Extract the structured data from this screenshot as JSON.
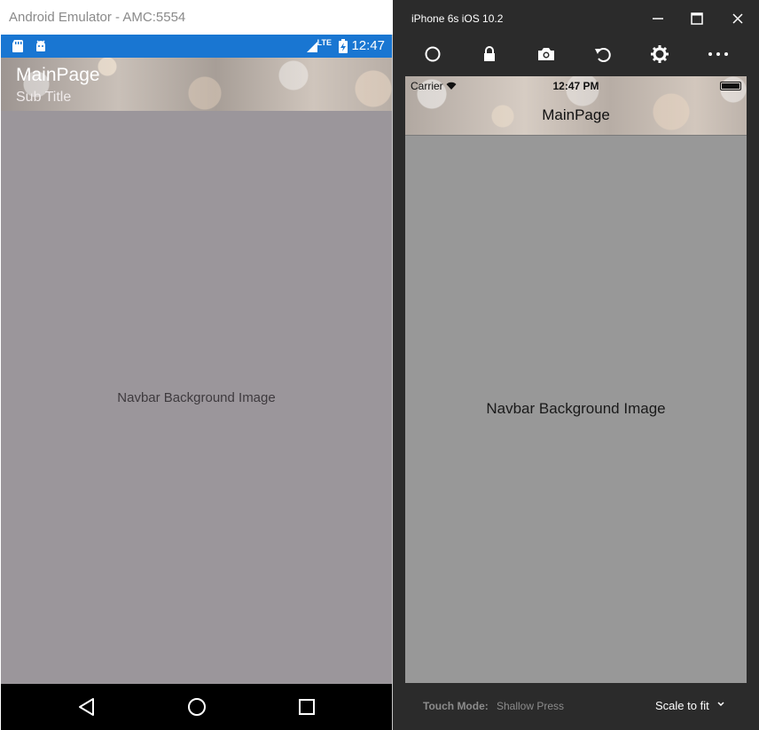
{
  "android": {
    "window_title": "Android Emulator - AMC:5554",
    "status_time": "12:47",
    "status_network": "LTE",
    "toolbar": {
      "title": "MainPage",
      "subtitle": "Sub Title"
    },
    "content_label": "Navbar Background Image",
    "nav_buttons": [
      "back-icon",
      "home-icon",
      "recents-icon"
    ],
    "colors": {
      "statusbar": "#1976d2",
      "content_bg": "#9b969b",
      "navbar": "#000000"
    }
  },
  "ios": {
    "window_title": "iPhone 6s iOS 10.2",
    "toolbar_icons": [
      "home-icon",
      "lock-icon",
      "camera-icon",
      "rotate-icon",
      "settings-icon",
      "more-icon"
    ],
    "carrier": "Carrier",
    "status_time": "12:47 PM",
    "nav_title": "MainPage",
    "content_label": "Navbar Background Image",
    "touch_mode_label": "Touch Mode:",
    "touch_mode_value": "Shallow Press",
    "scale_label": "Scale to fit",
    "colors": {
      "window_bg": "#2b2b2b",
      "content_bg": "#989898"
    }
  }
}
